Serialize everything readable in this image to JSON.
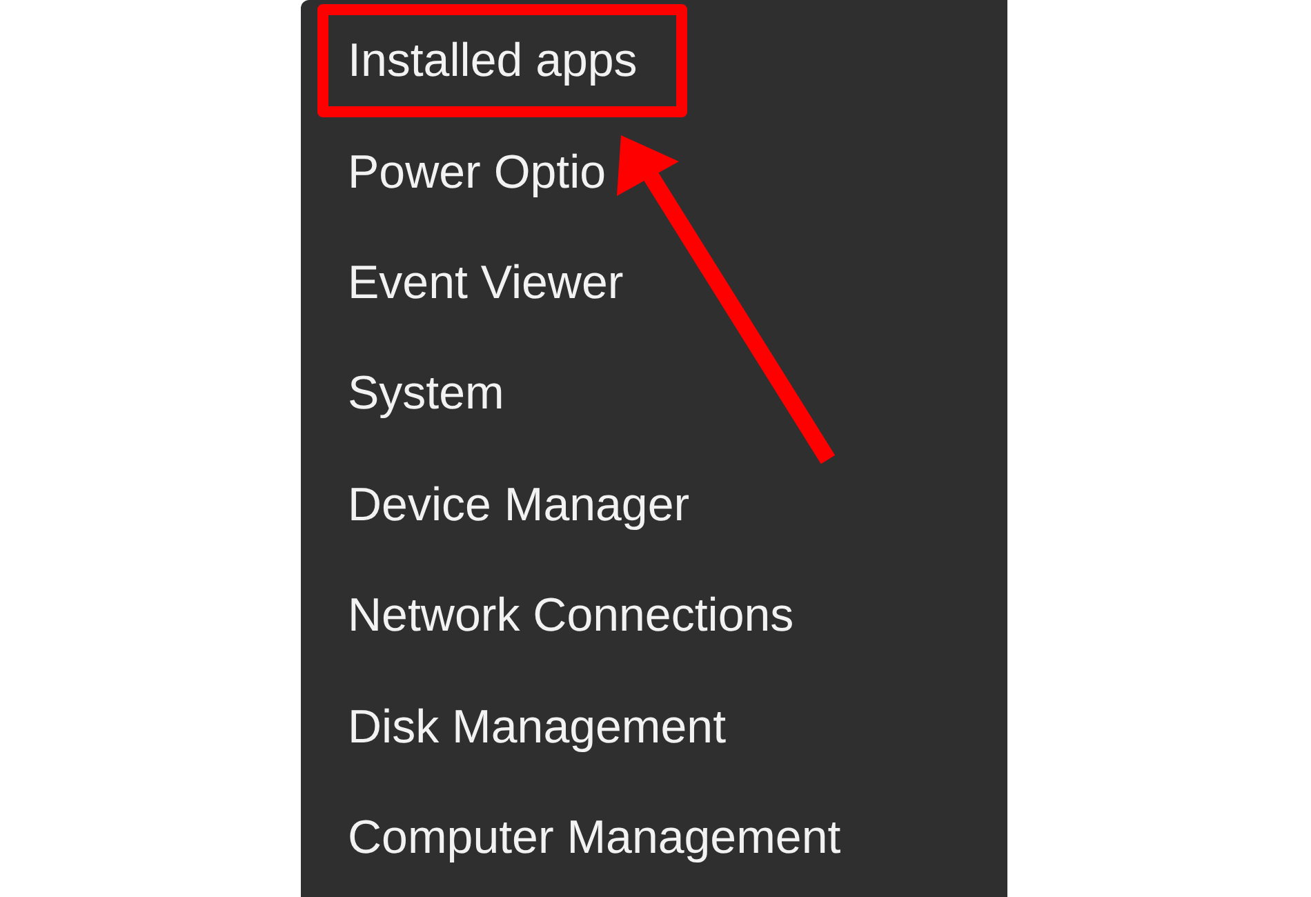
{
  "menu": {
    "items": [
      {
        "label": "Installed apps",
        "highlighted": true
      },
      {
        "label": "Power Optio",
        "highlighted": false
      },
      {
        "label": "Event Viewer",
        "highlighted": false
      },
      {
        "label": "System",
        "highlighted": false
      },
      {
        "label": "Device Manager",
        "highlighted": false
      },
      {
        "label": "Network Connections",
        "highlighted": false
      },
      {
        "label": "Disk Management",
        "highlighted": false
      },
      {
        "label": "Computer Management",
        "highlighted": false
      }
    ]
  }
}
